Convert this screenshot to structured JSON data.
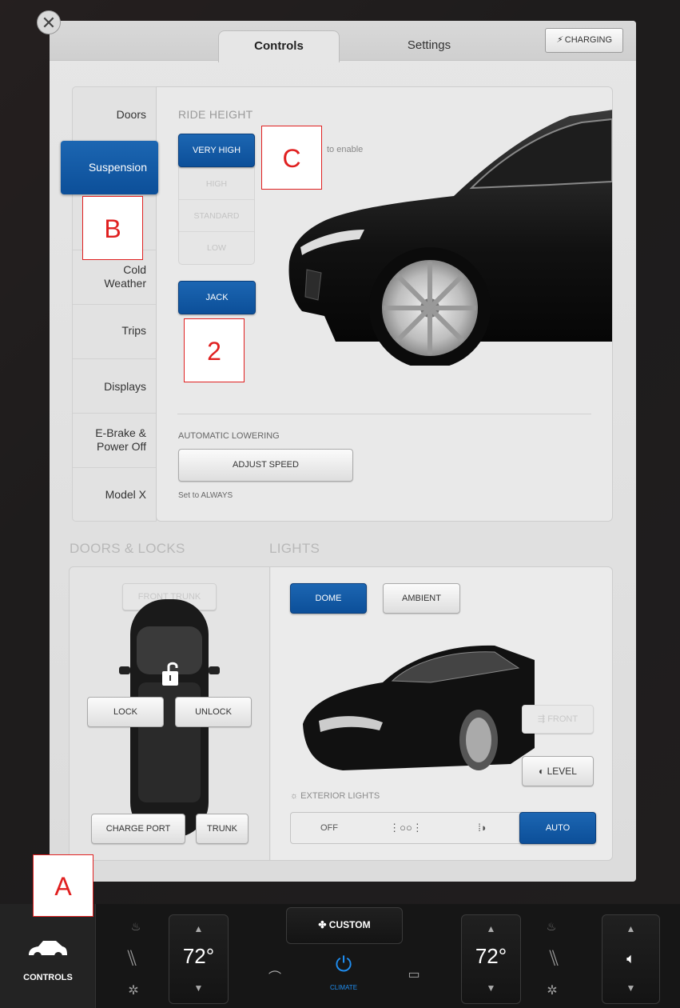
{
  "tabs": {
    "controls": "Controls",
    "settings": "Settings"
  },
  "charging_label": "CHARGING",
  "sidebar": {
    "items": [
      {
        "label": "Doors"
      },
      {
        "label": "Suspension"
      },
      {
        "label": "Cold\nWeather"
      },
      {
        "label": "Trips"
      },
      {
        "label": "Displays"
      },
      {
        "label": "E-Brake &\nPower Off"
      },
      {
        "label": "Model X"
      }
    ]
  },
  "suspension": {
    "title": "RIDE HEIGHT",
    "hint": "to enable",
    "options": [
      "VERY HIGH",
      "HIGH",
      "STANDARD",
      "LOW"
    ],
    "selected": "VERY HIGH",
    "jack_label": "JACK",
    "auto_lowering_title": "AUTOMATIC LOWERING",
    "adjust_speed_label": "ADJUST SPEED",
    "set_note": "Set to ALWAYS"
  },
  "doors_locks": {
    "title": "DOORS & LOCKS",
    "front_trunk": "FRONT TRUNK",
    "lock": "LOCK",
    "unlock": "UNLOCK",
    "charge_port": "CHARGE PORT",
    "trunk": "TRUNK"
  },
  "lights": {
    "title": "LIGHTS",
    "dome": "DOME",
    "ambient": "AMBIENT",
    "front": "FRONT",
    "level": "LEVEL",
    "exterior": "EXTERIOR LIGHTS",
    "modes": [
      "OFF",
      "",
      "",
      "AUTO"
    ],
    "selected_mode": "AUTO"
  },
  "footer": {
    "controls_label": "CONTROLS",
    "left_temp": "72°",
    "right_temp": "72°",
    "fan_label": "CUSTOM",
    "climate_label": "CLIMATE"
  },
  "annotations": {
    "a": "A",
    "b": "B",
    "c": "C",
    "two": "2"
  },
  "colors": {
    "accent": "#0c4f99",
    "panel": "#e4e4e4",
    "annotation": "#e02020"
  }
}
